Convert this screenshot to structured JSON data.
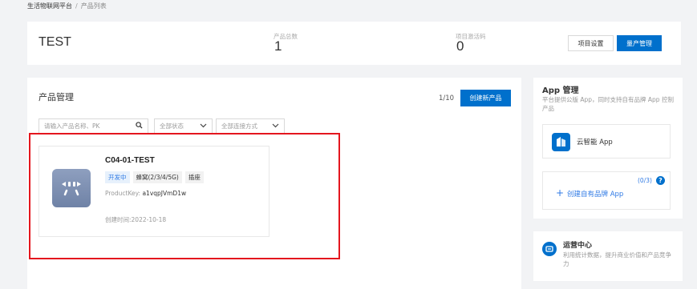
{
  "breadcrumb": {
    "root": "生活物联网平台",
    "separator": "/",
    "current": "产品列表"
  },
  "project": {
    "title": "TEST",
    "stats": [
      {
        "label": "产品总数",
        "value": "1"
      },
      {
        "label": "项目激活码",
        "value": "0"
      }
    ],
    "settings_button": "项目设置",
    "mass_production_button": "量产管理"
  },
  "products": {
    "section_title": "产品管理",
    "page_count": "1/10",
    "create_button": "创建新产品",
    "filters": {
      "search_placeholder": "请输入产品名称、PK",
      "status_select": "全部状态",
      "connection_select": "全部连接方式"
    },
    "items": [
      {
        "name": "C04-01-TEST",
        "tags": [
          "开发中",
          "蜂窝(2/3/4/5G)",
          "插座"
        ],
        "product_key_label": "ProductKey:",
        "product_key": "a1vqpJVmD1w",
        "created_label": "创建时间:",
        "created": "2022-10-18"
      }
    ]
  },
  "app_management": {
    "title": "App 管理",
    "description": "平台提供公版 App，同时支持自有品牌 App 控制产品",
    "public_app": "云智能 App",
    "brand_count": "(0/3)",
    "create_brand_app": "创建自有品牌 App"
  },
  "operations": {
    "title": "运营中心",
    "description": "利用统计数据，提升商业价值和产品竞争力"
  },
  "colors": {
    "primary": "#0070cc",
    "highlight": "#e4161e",
    "tag_blue": "#2f7ae5",
    "icon_bg": "#7a8cb0"
  }
}
